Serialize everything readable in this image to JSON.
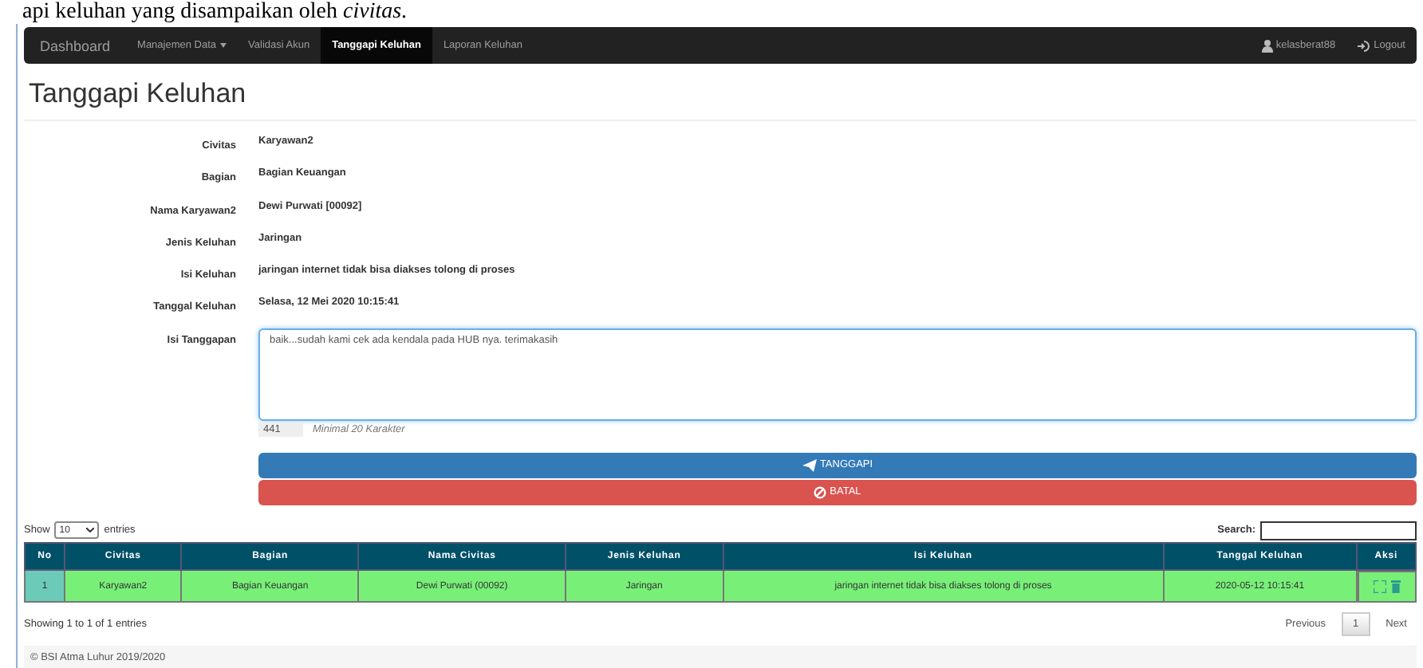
{
  "doc_text": "api keluhan yang disampaikan oleh *civitas*.",
  "navbar": {
    "items": [
      {
        "label": "Dashboard",
        "kind": "brand",
        "selected": false
      },
      {
        "label": "Manajemen Data",
        "kind": "dropdown",
        "selected": false
      },
      {
        "label": "Validasi Akun",
        "kind": "link",
        "selected": false
      },
      {
        "label": "Tanggapi Keluhan",
        "kind": "link",
        "selected": true
      },
      {
        "label": "Laporan Keluhan",
        "kind": "link",
        "selected": false
      }
    ],
    "user": "kelasberat88",
    "logout": "Logout"
  },
  "page_title": "Tanggapi Keluhan",
  "fields": [
    {
      "label": "Civitas",
      "value": "Karyawan2"
    },
    {
      "label": "Bagian",
      "value": "Bagian Keuangan"
    },
    {
      "label": "Nama Karyawan2",
      "value": "Dewi Purwati [00092]"
    },
    {
      "label": "Jenis Keluhan",
      "value": "Jaringan"
    },
    {
      "label": "Isi Keluhan",
      "value": "jaringan internet tidak bisa diakses tolong di proses"
    },
    {
      "label": "Tanggal Keluhan",
      "value": "Selasa, 12 Mei 2020 10:15:41"
    }
  ],
  "response": {
    "label": "Isi Tanggapan",
    "value": "baik...sudah kami cek ada kendala pada HUB nya. terimakasih",
    "counter": "441",
    "hint": "Minimal 20 Karakter"
  },
  "buttons": [
    {
      "label": "TANGGAPI",
      "kind": "primary"
    },
    {
      "label": "BATAL",
      "kind": "danger"
    }
  ],
  "table_controls": {
    "show": "Show",
    "page_size": "10",
    "entries": "entries",
    "search_label": "Search:"
  },
  "table": {
    "columns": [
      "No",
      "Civitas",
      "Bagian",
      "Nama Civitas",
      "Jenis Keluhan",
      "Isi Keluhan",
      "Tanggal Keluhan",
      "Aksi"
    ],
    "rows": [
      {
        "cells": [
          "1",
          "Karyawan2",
          "Bagian Keuangan",
          "Dewi Purwati (00092)",
          "Jaringan",
          "jaringan internet tidak bisa diakses tolong di proses",
          "2020-05-12 10:15:41"
        ]
      }
    ]
  },
  "info": "Showing 1 to 1 of 1 entries",
  "pagination": {
    "previous": "Previous",
    "pages": [
      {
        "label": "1",
        "selected": true
      }
    ],
    "next": "Next"
  },
  "footer": "© BSI Atma Luhur 2019/2020"
}
